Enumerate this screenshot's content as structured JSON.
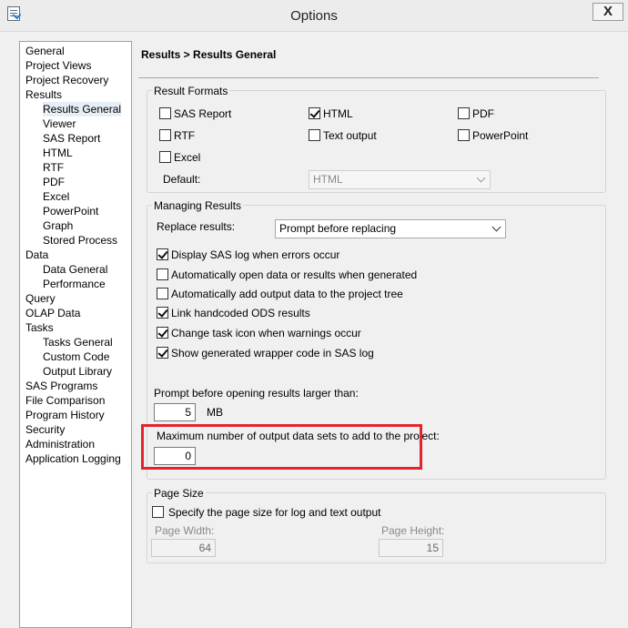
{
  "window": {
    "title": "Options",
    "close_label": "X"
  },
  "nav": {
    "items": [
      {
        "label": "General"
      },
      {
        "label": "Project Views"
      },
      {
        "label": "Project Recovery"
      },
      {
        "label": "Results"
      },
      {
        "label": "Results General"
      },
      {
        "label": "Viewer"
      },
      {
        "label": "SAS Report"
      },
      {
        "label": "HTML"
      },
      {
        "label": "RTF"
      },
      {
        "label": "PDF"
      },
      {
        "label": "Excel"
      },
      {
        "label": "PowerPoint"
      },
      {
        "label": "Graph"
      },
      {
        "label": "Stored Process"
      },
      {
        "label": "Data"
      },
      {
        "label": "Data General"
      },
      {
        "label": "Performance"
      },
      {
        "label": "Query"
      },
      {
        "label": "OLAP Data"
      },
      {
        "label": "Tasks"
      },
      {
        "label": "Tasks General"
      },
      {
        "label": "Custom Code"
      },
      {
        "label": "Output Library"
      },
      {
        "label": "SAS Programs"
      },
      {
        "label": "File Comparison"
      },
      {
        "label": "Program History"
      },
      {
        "label": "Security"
      },
      {
        "label": "Administration"
      },
      {
        "label": "Application Logging"
      }
    ]
  },
  "main": {
    "heading": "Results > Results General",
    "result_formats": {
      "title": "Result Formats",
      "options": [
        {
          "label": "SAS Report",
          "checked": false
        },
        {
          "label": "HTML",
          "checked": true
        },
        {
          "label": "PDF",
          "checked": false
        },
        {
          "label": "RTF",
          "checked": false
        },
        {
          "label": "Text output",
          "checked": false
        },
        {
          "label": "PowerPoint",
          "checked": false
        },
        {
          "label": "Excel",
          "checked": false
        }
      ],
      "default_label": "Default:",
      "default_value": "HTML"
    },
    "managing_results": {
      "title": "Managing Results",
      "replace_label": "Replace results:",
      "replace_value": "Prompt before replacing",
      "options": [
        {
          "label": "Display SAS log when errors occur",
          "checked": true
        },
        {
          "label": "Automatically open data or results when generated",
          "checked": false
        },
        {
          "label": "Automatically add output data to the project tree",
          "checked": false
        },
        {
          "label": "Link handcoded ODS results",
          "checked": true
        },
        {
          "label": "Change task icon when warnings occur",
          "checked": true
        },
        {
          "label": "Show generated wrapper code in SAS log",
          "checked": true
        }
      ],
      "prompt_label": "Prompt before opening results larger than:",
      "prompt_value": "5",
      "prompt_unit": "MB",
      "max_label": "Maximum number of output data sets to add to the project:",
      "max_value": "0"
    },
    "page_size": {
      "title": "Page Size",
      "specify_label": "Specify the page size for log and text output",
      "specify_checked": false,
      "width_label": "Page Width:",
      "width_value": "64",
      "height_label": "Page Height:",
      "height_value": "15"
    }
  },
  "colors": {
    "highlight": "#e3242b"
  }
}
